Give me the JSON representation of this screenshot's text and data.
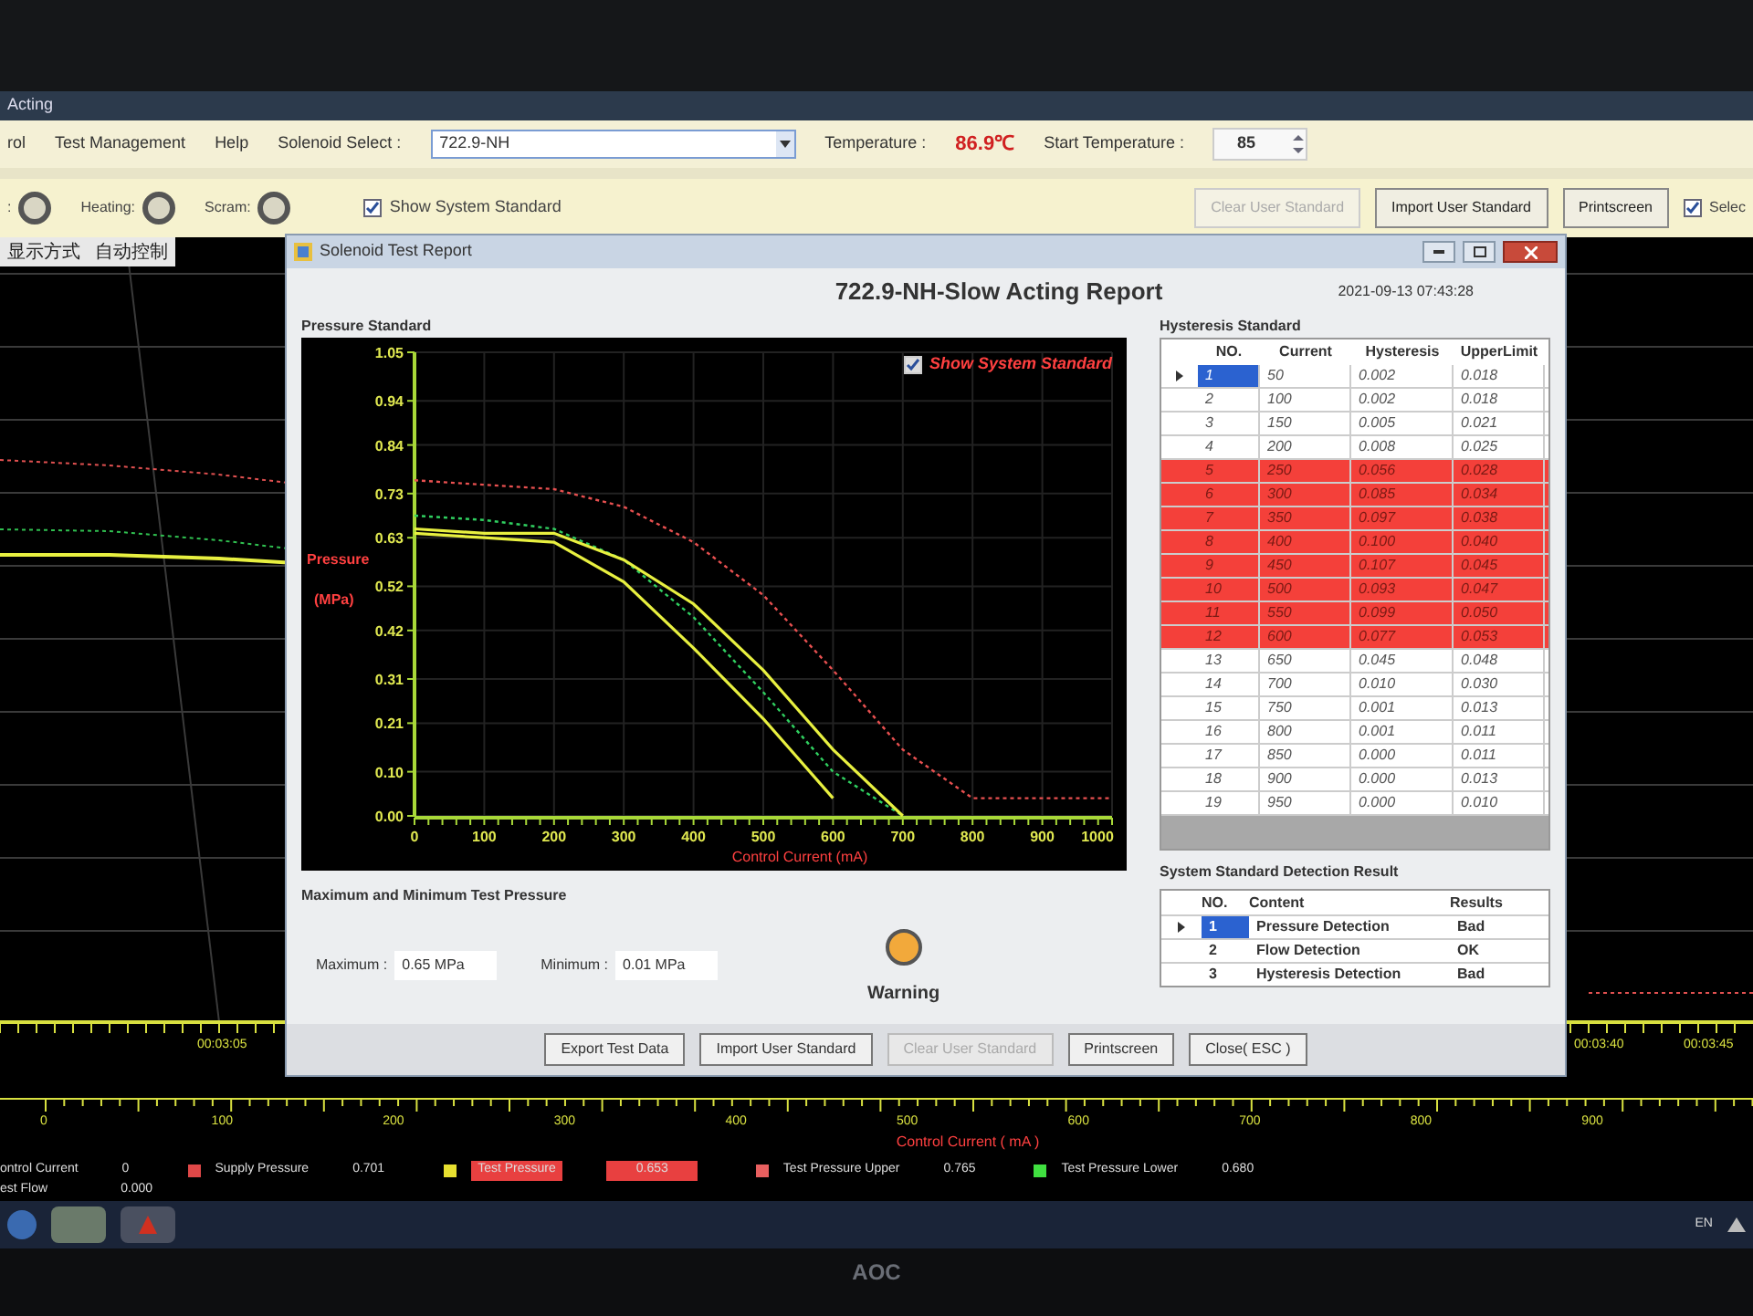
{
  "app_title": "Acting",
  "menu": [
    {
      "label": "rol"
    },
    {
      "label": "Test Management"
    },
    {
      "label": "Help"
    }
  ],
  "solenoid_select": {
    "label": "Solenoid Select :",
    "value": "722.9-NH"
  },
  "temperature": {
    "label": "Temperature :",
    "value": "86.9℃"
  },
  "start_temperature": {
    "label": "Start Temperature :",
    "value": "85"
  },
  "indicators": [
    {
      "label": ":",
      "on": false
    },
    {
      "label": "Heating:",
      "on": false
    },
    {
      "label": "Scram:",
      "on": false
    }
  ],
  "show_system_standard": {
    "label": "Show System Standard",
    "checked": true
  },
  "toolbar_buttons": [
    {
      "label": "Clear User Standard",
      "disabled": true
    },
    {
      "label": "Import User Standard",
      "disabled": false
    },
    {
      "label": "Printscreen",
      "disabled": false
    }
  ],
  "select_checkbox": {
    "label": "Selec",
    "checked": true
  },
  "mode_bar": {
    "display_mode": "显示方式",
    "control": "自动控制"
  },
  "background_chart": {
    "time_labels": [
      "00:03:05",
      "00:03:40",
      "00:03:45"
    ],
    "axis_labels": [
      "0",
      "100",
      "200",
      "300",
      "400",
      "500",
      "600",
      "700",
      "800",
      "900"
    ],
    "axis_title": "Control Current ( mA )"
  },
  "readings": [
    {
      "kind": "plain",
      "label": "ontrol Current",
      "value": "0"
    },
    {
      "kind": "series",
      "label": "Supply Pressure",
      "value": "0.701",
      "color": "#e04848",
      "alarm": false
    },
    {
      "kind": "series",
      "label": "Test Pressure",
      "value": "0.653",
      "color": "#e8e030",
      "alarm": true
    },
    {
      "kind": "series",
      "label": "Test Pressure Upper",
      "value": "0.765",
      "color": "#e86060",
      "alarm": false
    },
    {
      "kind": "series",
      "label": "Test Pressure Lower",
      "value": "0.680",
      "color": "#40e040",
      "alarm": false
    }
  ],
  "test_flow": {
    "label": "est Flow",
    "value": "0.000"
  },
  "taskbar": {
    "language": "EN"
  },
  "monitor_brand": "AOC",
  "dialog": {
    "title": "Solenoid Test Report",
    "report_title": "722.9-NH-Slow Acting Report",
    "timestamp": "2021-09-13 07:43:28",
    "pressure_section": "Pressure Standard",
    "chart_show_standard": {
      "label": "Show System Standard",
      "checked": true
    },
    "chart_data": {
      "type": "line",
      "xlabel": "Control Current (mA)",
      "ylabel": "Pressure (MPa)",
      "x": [
        0,
        100,
        200,
        300,
        400,
        500,
        600,
        700,
        800,
        900,
        1000
      ],
      "series": [
        {
          "color": "#e85050",
          "line_style": "dashed",
          "values": [
            0.76,
            0.75,
            0.74,
            0.7,
            0.62,
            0.5,
            0.33,
            0.15,
            0.04,
            0.04,
            0.04
          ]
        },
        {
          "color": "#30d060",
          "line_style": "dashed",
          "values": [
            0.68,
            0.67,
            0.65,
            0.58,
            0.45,
            0.28,
            0.1,
            0.0,
            null,
            null,
            null
          ]
        },
        {
          "color": "#e8f040",
          "line_style": "solid",
          "values": [
            0.65,
            0.64,
            0.64,
            0.58,
            0.48,
            0.33,
            0.15,
            0.0,
            null,
            null,
            null
          ]
        },
        {
          "color": "#e8f040",
          "line_style": "solid",
          "values": [
            0.64,
            0.63,
            0.62,
            0.53,
            0.38,
            0.22,
            0.04,
            null,
            null,
            null,
            null
          ]
        }
      ],
      "grid": true,
      "xlim": [
        0,
        1000
      ],
      "ylim": [
        0,
        1.05
      ],
      "xticks": [
        0,
        100,
        200,
        300,
        400,
        500,
        600,
        700,
        800,
        900,
        1000
      ],
      "yticks": [
        {
          "value": 0,
          "label": "0.00"
        },
        {
          "value": 0.1,
          "label": "0.10"
        },
        {
          "value": 0.21,
          "label": "0.21"
        },
        {
          "value": 0.31,
          "label": "0.31"
        },
        {
          "value": 0.42,
          "label": "0.42"
        },
        {
          "value": 0.52,
          "label": "0.52"
        },
        {
          "value": 0.63,
          "label": "0.63"
        },
        {
          "value": 0.73,
          "label": "0.73"
        },
        {
          "value": 0.84,
          "label": "0.84"
        },
        {
          "value": 0.94,
          "label": "0.94"
        },
        {
          "value": 1.05,
          "label": "1.05"
        }
      ]
    },
    "minmax_section": "Maximum and Minimum Test Pressure",
    "maximum": {
      "label": "Maximum :",
      "value": "0.65 MPa"
    },
    "minimum": {
      "label": "Minimum :",
      "value": "0.01 MPa"
    },
    "status": {
      "label": "Warning",
      "color": "#f2a93b"
    },
    "hysteresis_section": "Hysteresis Standard",
    "hysteresis_columns": [
      "NO.",
      "Current",
      "Hysteresis",
      "UpperLimit"
    ],
    "hysteresis_rows": [
      {
        "no": "1",
        "current": "50",
        "hysteresis": "0.002",
        "upper_limit": "0.018",
        "selected": true,
        "failed": false
      },
      {
        "no": "2",
        "current": "100",
        "hysteresis": "0.002",
        "upper_limit": "0.018",
        "selected": false,
        "failed": false
      },
      {
        "no": "3",
        "current": "150",
        "hysteresis": "0.005",
        "upper_limit": "0.021",
        "selected": false,
        "failed": false
      },
      {
        "no": "4",
        "current": "200",
        "hysteresis": "0.008",
        "upper_limit": "0.025",
        "selected": false,
        "failed": false
      },
      {
        "no": "5",
        "current": "250",
        "hysteresis": "0.056",
        "upper_limit": "0.028",
        "selected": false,
        "failed": true
      },
      {
        "no": "6",
        "current": "300",
        "hysteresis": "0.085",
        "upper_limit": "0.034",
        "selected": false,
        "failed": true
      },
      {
        "no": "7",
        "current": "350",
        "hysteresis": "0.097",
        "upper_limit": "0.038",
        "selected": false,
        "failed": true
      },
      {
        "no": "8",
        "current": "400",
        "hysteresis": "0.100",
        "upper_limit": "0.040",
        "selected": false,
        "failed": true
      },
      {
        "no": "9",
        "current": "450",
        "hysteresis": "0.107",
        "upper_limit": "0.045",
        "selected": false,
        "failed": true
      },
      {
        "no": "10",
        "current": "500",
        "hysteresis": "0.093",
        "upper_limit": "0.047",
        "selected": false,
        "failed": true
      },
      {
        "no": "11",
        "current": "550",
        "hysteresis": "0.099",
        "upper_limit": "0.050",
        "selected": false,
        "failed": true
      },
      {
        "no": "12",
        "current": "600",
        "hysteresis": "0.077",
        "upper_limit": "0.053",
        "selected": false,
        "failed": true
      },
      {
        "no": "13",
        "current": "650",
        "hysteresis": "0.045",
        "upper_limit": "0.048",
        "selected": false,
        "failed": false
      },
      {
        "no": "14",
        "current": "700",
        "hysteresis": "0.010",
        "upper_limit": "0.030",
        "selected": false,
        "failed": false
      },
      {
        "no": "15",
        "current": "750",
        "hysteresis": "0.001",
        "upper_limit": "0.013",
        "selected": false,
        "failed": false
      },
      {
        "no": "16",
        "current": "800",
        "hysteresis": "0.001",
        "upper_limit": "0.011",
        "selected": false,
        "failed": false
      },
      {
        "no": "17",
        "current": "850",
        "hysteresis": "0.000",
        "upper_limit": "0.011",
        "selected": false,
        "failed": false
      },
      {
        "no": "18",
        "current": "900",
        "hysteresis": "0.000",
        "upper_limit": "0.013",
        "selected": false,
        "failed": false
      },
      {
        "no": "19",
        "current": "950",
        "hysteresis": "0.000",
        "upper_limit": "0.010",
        "selected": false,
        "failed": false
      }
    ],
    "detection_section": "System Standard Detection Result",
    "detection_columns": [
      "NO.",
      "Content",
      "Results"
    ],
    "detection_rows": [
      {
        "no": "1",
        "content": "Pressure Detection",
        "result": "Bad",
        "selected": true
      },
      {
        "no": "2",
        "content": "Flow Detection",
        "result": "OK",
        "selected": false
      },
      {
        "no": "3",
        "content": "Hysteresis Detection",
        "result": "Bad",
        "selected": false
      }
    ],
    "buttons": [
      {
        "label": "Export Test Data",
        "disabled": false
      },
      {
        "label": "Import User Standard",
        "disabled": false
      },
      {
        "label": "Clear User Standard",
        "disabled": true
      },
      {
        "label": "Printscreen",
        "disabled": false
      },
      {
        "label": "Close( ESC )",
        "disabled": false
      }
    ]
  }
}
